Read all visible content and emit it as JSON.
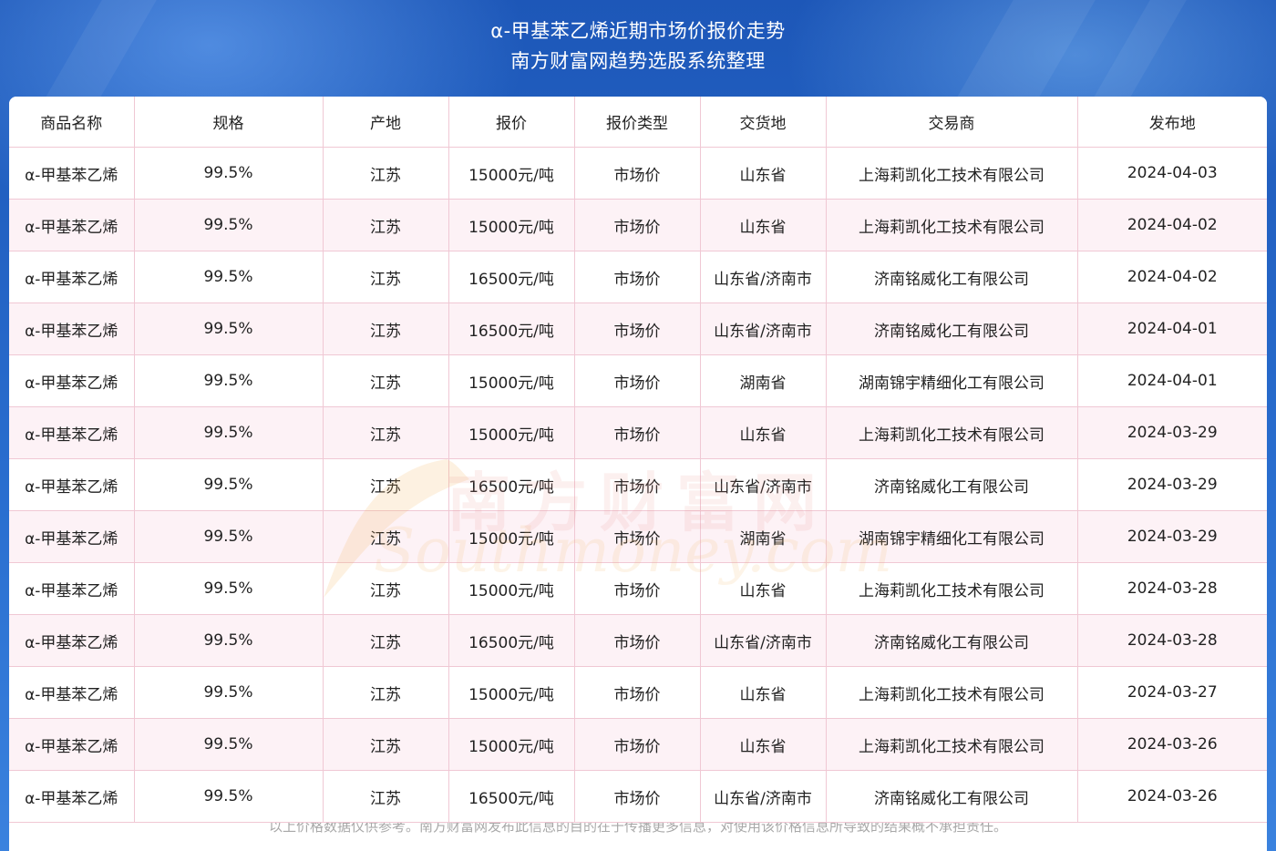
{
  "header": {
    "title_line1": "α-甲基苯乙烯近期市场价报价走势",
    "title_line2": "南方财富网趋势选股系统整理"
  },
  "table": {
    "columns": [
      "商品名称",
      "规格",
      "产地",
      "报价",
      "报价类型",
      "交货地",
      "交易商",
      "发布地"
    ],
    "rows": [
      [
        "α-甲基苯乙烯",
        "99.5%",
        "江苏",
        "15000元/吨",
        "市场价",
        "山东省",
        "上海莉凯化工技术有限公司",
        "2024-04-03"
      ],
      [
        "α-甲基苯乙烯",
        "99.5%",
        "江苏",
        "15000元/吨",
        "市场价",
        "山东省",
        "上海莉凯化工技术有限公司",
        "2024-04-02"
      ],
      [
        "α-甲基苯乙烯",
        "99.5%",
        "江苏",
        "16500元/吨",
        "市场价",
        "山东省/济南市",
        "济南铭威化工有限公司",
        "2024-04-02"
      ],
      [
        "α-甲基苯乙烯",
        "99.5%",
        "江苏",
        "16500元/吨",
        "市场价",
        "山东省/济南市",
        "济南铭威化工有限公司",
        "2024-04-01"
      ],
      [
        "α-甲基苯乙烯",
        "99.5%",
        "江苏",
        "15000元/吨",
        "市场价",
        "湖南省",
        "湖南锦宇精细化工有限公司",
        "2024-04-01"
      ],
      [
        "α-甲基苯乙烯",
        "99.5%",
        "江苏",
        "15000元/吨",
        "市场价",
        "山东省",
        "上海莉凯化工技术有限公司",
        "2024-03-29"
      ],
      [
        "α-甲基苯乙烯",
        "99.5%",
        "江苏",
        "16500元/吨",
        "市场价",
        "山东省/济南市",
        "济南铭威化工有限公司",
        "2024-03-29"
      ],
      [
        "α-甲基苯乙烯",
        "99.5%",
        "江苏",
        "15000元/吨",
        "市场价",
        "湖南省",
        "湖南锦宇精细化工有限公司",
        "2024-03-29"
      ],
      [
        "α-甲基苯乙烯",
        "99.5%",
        "江苏",
        "15000元/吨",
        "市场价",
        "山东省",
        "上海莉凯化工技术有限公司",
        "2024-03-28"
      ],
      [
        "α-甲基苯乙烯",
        "99.5%",
        "江苏",
        "16500元/吨",
        "市场价",
        "山东省/济南市",
        "济南铭威化工有限公司",
        "2024-03-28"
      ],
      [
        "α-甲基苯乙烯",
        "99.5%",
        "江苏",
        "15000元/吨",
        "市场价",
        "山东省",
        "上海莉凯化工技术有限公司",
        "2024-03-27"
      ],
      [
        "α-甲基苯乙烯",
        "99.5%",
        "江苏",
        "15000元/吨",
        "市场价",
        "山东省",
        "上海莉凯化工技术有限公司",
        "2024-03-26"
      ],
      [
        "α-甲基苯乙烯",
        "99.5%",
        "江苏",
        "16500元/吨",
        "市场价",
        "山东省/济南市",
        "济南铭威化工有限公司",
        "2024-03-26"
      ]
    ]
  },
  "watermark": {
    "cn": "南方财富网",
    "en": "Southmoney.com"
  },
  "footer": {
    "disclaimer": "以上价格数据仅供参考。南方财富网发布此信息的目的在于传播更多信息，对使用该价格信息所导致的结果概不承担责任。"
  }
}
